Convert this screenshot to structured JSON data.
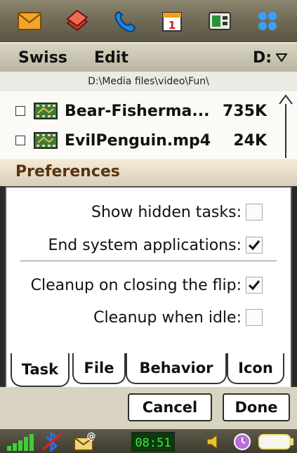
{
  "menubar": {
    "menu1": "Swiss",
    "menu2": "Edit",
    "drive": "D:"
  },
  "path": "D:\\Media files\\video\\Fun\\",
  "files": [
    {
      "name": "Bear-Fisherma...",
      "size": "735K"
    },
    {
      "name": "EvilPenguin.mp4",
      "size": "24K"
    }
  ],
  "dialog": {
    "title": "Preferences",
    "options": [
      {
        "label": "Show hidden tasks:",
        "checked": false
      },
      {
        "label": "End system applications:",
        "checked": true
      },
      {
        "label": "Cleanup on closing the flip:",
        "checked": true
      },
      {
        "label": "Cleanup when idle:",
        "checked": false
      }
    ],
    "tabs": [
      "Task",
      "File",
      "Behavior",
      "Icon"
    ],
    "active_tab": "Task",
    "buttons": {
      "cancel": "Cancel",
      "done": "Done"
    }
  },
  "status": {
    "clock": "08:51"
  },
  "icons": {
    "appbar": [
      "envelope-icon",
      "books-icon",
      "phone-icon",
      "calendar-icon",
      "media-icon",
      "apps-grid-icon"
    ],
    "statusbar": [
      "signal-icon",
      "bluetooth-icon",
      "mail-at-icon",
      "speaker-icon",
      "alarm-clock-icon",
      "battery-icon"
    ]
  },
  "colors": {
    "dialog_title": "#5a3410",
    "clock_text": "#41e64a"
  }
}
